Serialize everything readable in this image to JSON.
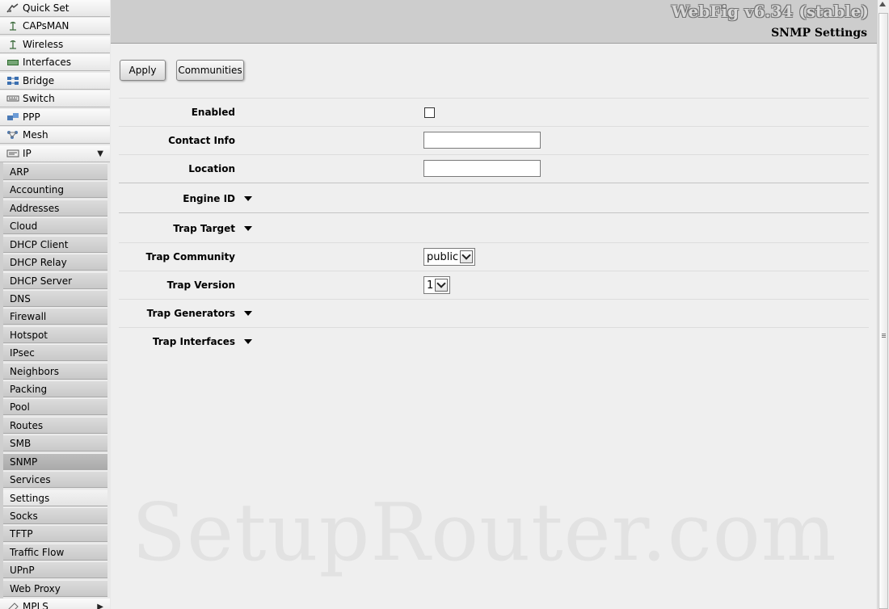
{
  "app": {
    "version": "WebFig v6.34 (stable)",
    "page_title": "SNMP Settings",
    "watermark": "SetupRouter.com"
  },
  "sidebar": {
    "top_items": [
      {
        "label": "Quick Set",
        "icon": "quick-set-icon"
      },
      {
        "label": "CAPsMAN",
        "icon": "antenna-icon"
      },
      {
        "label": "Wireless",
        "icon": "antenna-icon"
      },
      {
        "label": "Interfaces",
        "icon": "interfaces-icon"
      },
      {
        "label": "Bridge",
        "icon": "bridge-icon"
      },
      {
        "label": "Switch",
        "icon": "switch-icon"
      },
      {
        "label": "PPP",
        "icon": "ppp-icon"
      },
      {
        "label": "Mesh",
        "icon": "mesh-icon"
      },
      {
        "label": "IP",
        "icon": "ip-icon",
        "expanded_arrow": "▼"
      }
    ],
    "ip_subitems": [
      "ARP",
      "Accounting",
      "Addresses",
      "Cloud",
      "DHCP Client",
      "DHCP Relay",
      "DHCP Server",
      "DNS",
      "Firewall",
      "Hotspot",
      "IPsec",
      "Neighbors",
      "Packing",
      "Pool",
      "Routes",
      "SMB",
      "SNMP",
      "Services",
      "Settings",
      "Socks",
      "TFTP",
      "Traffic Flow",
      "UPnP",
      "Web Proxy"
    ],
    "selected": "SNMP",
    "bottom_item": {
      "label": "MPLS",
      "icon": "mpls-icon",
      "arrow": "▶"
    }
  },
  "toolbar": {
    "apply_label": "Apply",
    "communities_label": "Communities"
  },
  "form": {
    "enabled_label": "Enabled",
    "contact_info_label": "Contact Info",
    "contact_info_value": "",
    "location_label": "Location",
    "location_value": "",
    "engine_id_label": "Engine ID",
    "trap_target_label": "Trap Target",
    "trap_community_label": "Trap Community",
    "trap_community_value": "public",
    "trap_version_label": "Trap Version",
    "trap_version_value": "1",
    "trap_generators_label": "Trap Generators",
    "trap_interfaces_label": "Trap Interfaces"
  }
}
